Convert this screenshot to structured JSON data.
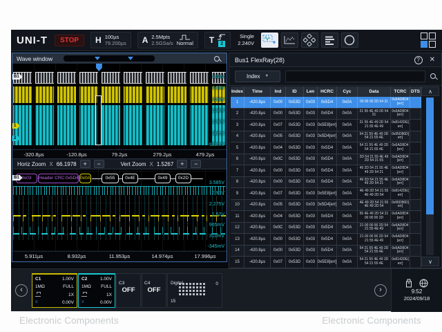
{
  "watermark": {
    "left": "Electronic Components",
    "right": "Electronic Components",
    "reg": "®"
  },
  "topbar": {
    "brand": "UNI-T",
    "stop": "STOP",
    "h_label": "H",
    "h_line1": "100µs",
    "h_line2": "79.200µs",
    "a_label": "A",
    "a_line1": "2.5Mpts",
    "a_line2": "2.5GSa/s",
    "a_mode": "Normal",
    "t_label": "T",
    "t_channel": "2",
    "trig_mode": "Single",
    "trig_level": "2.240V"
  },
  "wave": {
    "title": "Wave window",
    "full": {
      "bus_tag": "B1",
      "ch1_tag": "1",
      "ch2_tag": "2",
      "v_labels": [
        "5.08V",
        "4.08V",
        "3.08V",
        "2.08V",
        "1.08V",
        "80mV",
        "-920mV"
      ],
      "t_labels": [
        "-320.8µs",
        "-120.8µs",
        "79.2µs",
        "279.2µs",
        "479.2µs"
      ]
    },
    "zoomctrl": {
      "horiz_label": "Horiz Zoom",
      "mult": "X",
      "horiz_value": "66.1978",
      "vert_label": "Vert Zoom",
      "vert_value": "1.5267",
      "plus": "+",
      "minus": "−"
    },
    "zoom": {
      "bus_tag": "B1",
      "decode": [
        {
          "text": "0x03",
          "type": "purple"
        },
        {
          "text": "Header CRC:0x5D4",
          "type": "purple"
        },
        {
          "text": "0x0A",
          "type": "yellow"
        },
        {
          "text": "0x55",
          "type": "white"
        },
        {
          "text": "0x4E",
          "type": "white"
        },
        {
          "text": "0x49",
          "type": "white"
        },
        {
          "text": "0x2D",
          "type": "white"
        }
      ],
      "v_labels": [
        "3.585V",
        "2.93V",
        "2.275V",
        "1.62V",
        "965mV",
        "310mV",
        "-345mV"
      ],
      "t_labels": [
        "5.911µs",
        "8.932µs",
        "11.953µs",
        "14.974µs",
        "17.996µs"
      ]
    }
  },
  "bus_table": {
    "title": "Bus1 FlexRay(28)",
    "help": "?",
    "close": "✕",
    "filter_label": "Index",
    "dropdown": "▼",
    "scroll_up": "∧",
    "scroll_down": "∨",
    "columns": [
      "Index",
      "Time",
      "Ind",
      "ID",
      "Len",
      "HCRC",
      "Cyc",
      "Data",
      "TCRC",
      "DTS"
    ],
    "rows": [
      {
        "index": "1",
        "time": "-420.8µs",
        "ind": "0x00",
        "id": "0x53D",
        "len": "0x03",
        "hcrc": "0x5D4",
        "cyc": "0x0A",
        "data": "00 00 00 2D 54 21",
        "tcrc": "0x6AD8D4[err]",
        "dts": "",
        "selected": true
      },
      {
        "index": "2",
        "time": "-420.8µs",
        "ind": "0x00",
        "id": "0x53D",
        "len": "0x03",
        "hcrc": "0x5D4",
        "cyc": "0x0A",
        "data": "21 55 4E 49 2D 54 21",
        "tcrc": "0x6AD8D4[err]",
        "dts": "",
        "selected": false
      },
      {
        "index": "3",
        "time": "-420.8µs",
        "ind": "0x07",
        "id": "0x53D",
        "len": "0x03",
        "hcrc": "0x5E8[err]",
        "cyc": "0x0A",
        "data": "21 55 4E 49 2D 54 21 55 4E 49",
        "tcrc": "0x8142DE[err]",
        "dts": "",
        "selected": false
      },
      {
        "index": "4",
        "time": "-420.8µs",
        "ind": "0x05",
        "id": "0x53D",
        "len": "0x03",
        "hcrc": "0x5D4[err]",
        "cyc": "0x0A",
        "data": "54 21 55 4E 49 2D 54 21 55 4E",
        "tcrc": "0x95D86D[err]",
        "dts": "",
        "selected": false
      },
      {
        "index": "5",
        "time": "-420.8µs",
        "ind": "0x04",
        "id": "0x53D",
        "len": "0x03",
        "hcrc": "0x5D4",
        "cyc": "0x0A",
        "data": "54 21 55 4E 49 2D 54 21 55 4E",
        "tcrc": "0x6AD8D4[err]",
        "dts": "",
        "selected": false
      },
      {
        "index": "6",
        "time": "-420.8µs",
        "ind": "0x0C",
        "id": "0x53D",
        "len": "0x03",
        "hcrc": "0x5D4",
        "cyc": "0x0A",
        "data": "2D 54 21 55 4E 49 2D 54 21 55",
        "tcrc": "0x6AD8D4[err]",
        "dts": "",
        "selected": false
      },
      {
        "index": "7",
        "time": "-420.8µs",
        "ind": "0x00",
        "id": "0x53D",
        "len": "0x03",
        "hcrc": "0x5D4",
        "cyc": "0x0A",
        "data": "49 2D 54 21 55 4E 49 2D 54 21",
        "tcrc": "0x6AD8D4[err]",
        "dts": "",
        "selected": false
      },
      {
        "index": "8",
        "time": "-420.8µs",
        "ind": "0x00",
        "id": "0x53D",
        "len": "0x03",
        "hcrc": "0x5D4",
        "cyc": "0x0A",
        "data": "49 2D 54 21 55 4E 49 2D 54 21",
        "tcrc": "0x6AD8D4[err]",
        "dts": "",
        "selected": false
      },
      {
        "index": "9",
        "time": "-420.8µs",
        "ind": "0x07",
        "id": "0x53D",
        "len": "0x03",
        "hcrc": "0x5E8[err]",
        "cyc": "0x0A",
        "data": "4E 49 2D 54 21 55 4E 49 2D 54",
        "tcrc": "0x8142DE[err]",
        "dts": "",
        "selected": false
      },
      {
        "index": "10",
        "time": "-420.8µs",
        "ind": "0x05",
        "id": "0x53D",
        "len": "0x03",
        "hcrc": "0x5D4[err]",
        "cyc": "0x0A",
        "data": "4E 49 2D 54 21 55 4E 49 2D 54",
        "tcrc": "0x95D86D[err]",
        "dts": "",
        "selected": false
      },
      {
        "index": "11",
        "time": "-420.8µs",
        "ind": "0x04",
        "id": "0x53D",
        "len": "0x03",
        "hcrc": "0x5D4",
        "cyc": "0x0A",
        "data": "55 4E 49 2D 54 21 00 00 00 2D",
        "tcrc": "0x6AD8D4[err]",
        "dts": "",
        "selected": false
      },
      {
        "index": "12",
        "time": "-420.8µs",
        "ind": "0x0C",
        "id": "0x53D",
        "len": "0x03",
        "hcrc": "0x5D4",
        "cyc": "0x0A",
        "data": "21 00 00 00 2D 54 21 55 4E 49",
        "tcrc": "0x6AD8D4[err]",
        "dts": "",
        "selected": false
      },
      {
        "index": "13",
        "time": "-420.8µs",
        "ind": "0x00",
        "id": "0x53D",
        "len": "0x03",
        "hcrc": "0x5D4",
        "cyc": "0x0A",
        "data": "21 00 00 00 2D 54 21 55 4E 49",
        "tcrc": "0x6AD8D4[err]",
        "dts": "",
        "selected": false
      },
      {
        "index": "14",
        "time": "-420.8µs",
        "ind": "0x00",
        "id": "0x53D",
        "len": "0x03",
        "hcrc": "0x5D4",
        "cyc": "0x0A",
        "data": "54 21 55 4E 49 2D 54 21 55 4E",
        "tcrc": "0x6AD8D4[err]",
        "dts": "",
        "selected": false
      },
      {
        "index": "15",
        "time": "-420.8µs",
        "ind": "0x07",
        "id": "0x53D",
        "len": "0x03",
        "hcrc": "0x5E8[err]",
        "cyc": "0x0A",
        "data": "54 21 55 4E 49 2D 54 21 55 4E",
        "tcrc": "0x8142DE[err]",
        "dts": "",
        "selected": false
      }
    ]
  },
  "bottombar": {
    "chevron_left": "‹",
    "chevron_right": "›",
    "c1": {
      "name": "C1",
      "scale": "1.00V",
      "imp": "1MΩ",
      "bw": "FULL",
      "probe": "1X",
      "offset": "0.00V"
    },
    "c2": {
      "name": "C2",
      "scale": "1.00V",
      "imp": "1MΩ",
      "bw": "FULL",
      "probe": "1X",
      "offset": "0.00V"
    },
    "c3": {
      "name": "C3",
      "state": "OFF"
    },
    "c4": {
      "name": "C4",
      "state": "OFF"
    },
    "digital": {
      "label": "Digital",
      "top": "0",
      "bottom": "15"
    },
    "clock": {
      "time": "9:52",
      "date": "2024/09/18"
    }
  }
}
